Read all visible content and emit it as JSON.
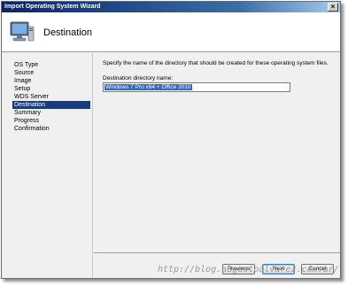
{
  "window": {
    "title": "Import Operating System Wizard",
    "close_glyph": "×"
  },
  "header": {
    "title": "Destination",
    "icon": "computer-monitor-icon"
  },
  "sidebar": {
    "steps": [
      {
        "label": "OS Type",
        "active": false
      },
      {
        "label": "Source",
        "active": false
      },
      {
        "label": "Image",
        "active": false
      },
      {
        "label": "Setup",
        "active": false
      },
      {
        "label": "WDS Server",
        "active": false
      },
      {
        "label": "Destination",
        "active": true
      },
      {
        "label": "Summary",
        "active": false
      },
      {
        "label": "Progress",
        "active": false
      },
      {
        "label": "Confirmation",
        "active": false
      }
    ]
  },
  "content": {
    "instruction": "Specify the name of the directory that should be created for these operating system files.",
    "field_label": "Destination directory name:",
    "field_value": "Windows 7 Pro x64 + Office 2010"
  },
  "buttons": {
    "previous": "Previous",
    "next": "Next",
    "cancel": "Cancel"
  },
  "watermark": "http://blog.augustoalvarez.com.ar/",
  "colors": {
    "active_step": "#1a3c7a",
    "selection": "#3068c0",
    "titlebar": "#0a246a"
  }
}
